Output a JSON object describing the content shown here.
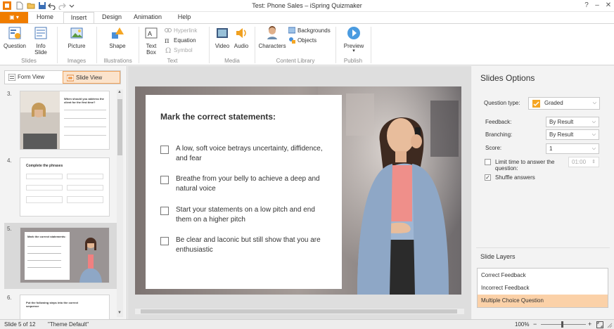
{
  "window": {
    "title": "Test: Phone Sales – iSpring Quizmaker"
  },
  "ribbon_tabs": [
    {
      "label": "Home"
    },
    {
      "label": "Insert"
    },
    {
      "label": "Design"
    },
    {
      "label": "Animation"
    },
    {
      "label": "Help"
    }
  ],
  "ribbon": {
    "slides": {
      "question": "Question",
      "info_slide": "Info\nSlide",
      "group": "Slides"
    },
    "images": {
      "picture": "Picture",
      "group": "Images"
    },
    "illustrations": {
      "shape": "Shape",
      "group": "Illustrations"
    },
    "text": {
      "text_box": "Text\nBox",
      "hyperlink": "Hyperlink",
      "equation": "Equation",
      "symbol": "Symbol",
      "group": "Text"
    },
    "media": {
      "video": "Video",
      "audio": "Audio",
      "group": "Media"
    },
    "content_library": {
      "characters": "Characters",
      "backgrounds": "Backgrounds",
      "objects": "Objects",
      "group": "Content Library"
    },
    "publish": {
      "preview": "Preview",
      "group": "Publish"
    }
  },
  "view_toggle": {
    "form_view": "Form View",
    "slide_view": "Slide View"
  },
  "thumbnails": [
    {
      "number": "3.",
      "title": "",
      "lines": [
        "When should you address the client for the first time?"
      ]
    },
    {
      "number": "4.",
      "title": "Complete the phrases",
      "lines": []
    },
    {
      "number": "5.",
      "title": "Mark the correct statements:",
      "lines": []
    },
    {
      "number": "6.",
      "title": "Put the following steps into the correct sequence",
      "lines": []
    }
  ],
  "slide": {
    "question_title": "Mark the correct statements:",
    "options": [
      {
        "text": "A low, soft voice betrays uncertainty, diffidence, and fear"
      },
      {
        "text": "Breathe from your belly to achieve a deep and natural voice"
      },
      {
        "text": "Start your statements on a low pitch and end them on a higher pitch"
      },
      {
        "text": "Be clear and laconic but still show that you are enthusiastic"
      }
    ]
  },
  "slide_options": {
    "title": "Slides Options",
    "question_type_label": "Question type:",
    "question_type_value": "Graded",
    "feedback_label": "Feedback:",
    "feedback_value": "By Result",
    "branching_label": "Branching:",
    "branching_value": "By Result",
    "score_label": "Score:",
    "score_value": "1",
    "limit_time_label": "Limit time to answer the question:",
    "limit_time_value": "01:00",
    "limit_time_checked": false,
    "shuffle_label": "Shuffle answers",
    "shuffle_checked": true
  },
  "slide_layers": {
    "title": "Slide Layers",
    "items": [
      {
        "label": "Correct Feedback",
        "selected": false
      },
      {
        "label": "Incorrect Feedback",
        "selected": false
      },
      {
        "label": "Multiple Choice Question",
        "selected": true
      }
    ]
  },
  "status": {
    "slide_position": "Slide 5 of 12",
    "theme": "\"Theme Default\"",
    "zoom": "100%"
  },
  "colors": {
    "accent": "#f07d00",
    "selected_layer": "#fbd1a8",
    "toggle_active": "#fbe3cc"
  }
}
